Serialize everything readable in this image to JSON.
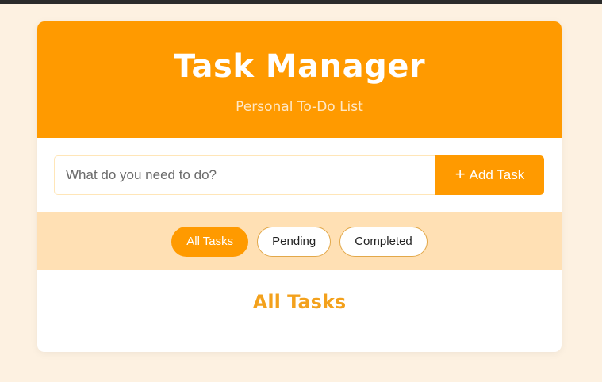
{
  "header": {
    "title": "Task Manager",
    "subtitle": "Personal To-Do List"
  },
  "task_input": {
    "placeholder": "What do you need to do?",
    "value": ""
  },
  "add_button": {
    "icon": "plus-icon",
    "icon_glyph": "+",
    "label": "Add Task"
  },
  "filters": [
    {
      "label": "All Tasks",
      "active": true
    },
    {
      "label": "Pending",
      "active": false
    },
    {
      "label": "Completed",
      "active": false
    }
  ],
  "section": {
    "title": "All Tasks"
  },
  "colors": {
    "accent": "#ff9a00",
    "page_background": "#fdf1e1",
    "filter_bar_background": "#ffe0b4",
    "section_title": "#f3a11c"
  }
}
